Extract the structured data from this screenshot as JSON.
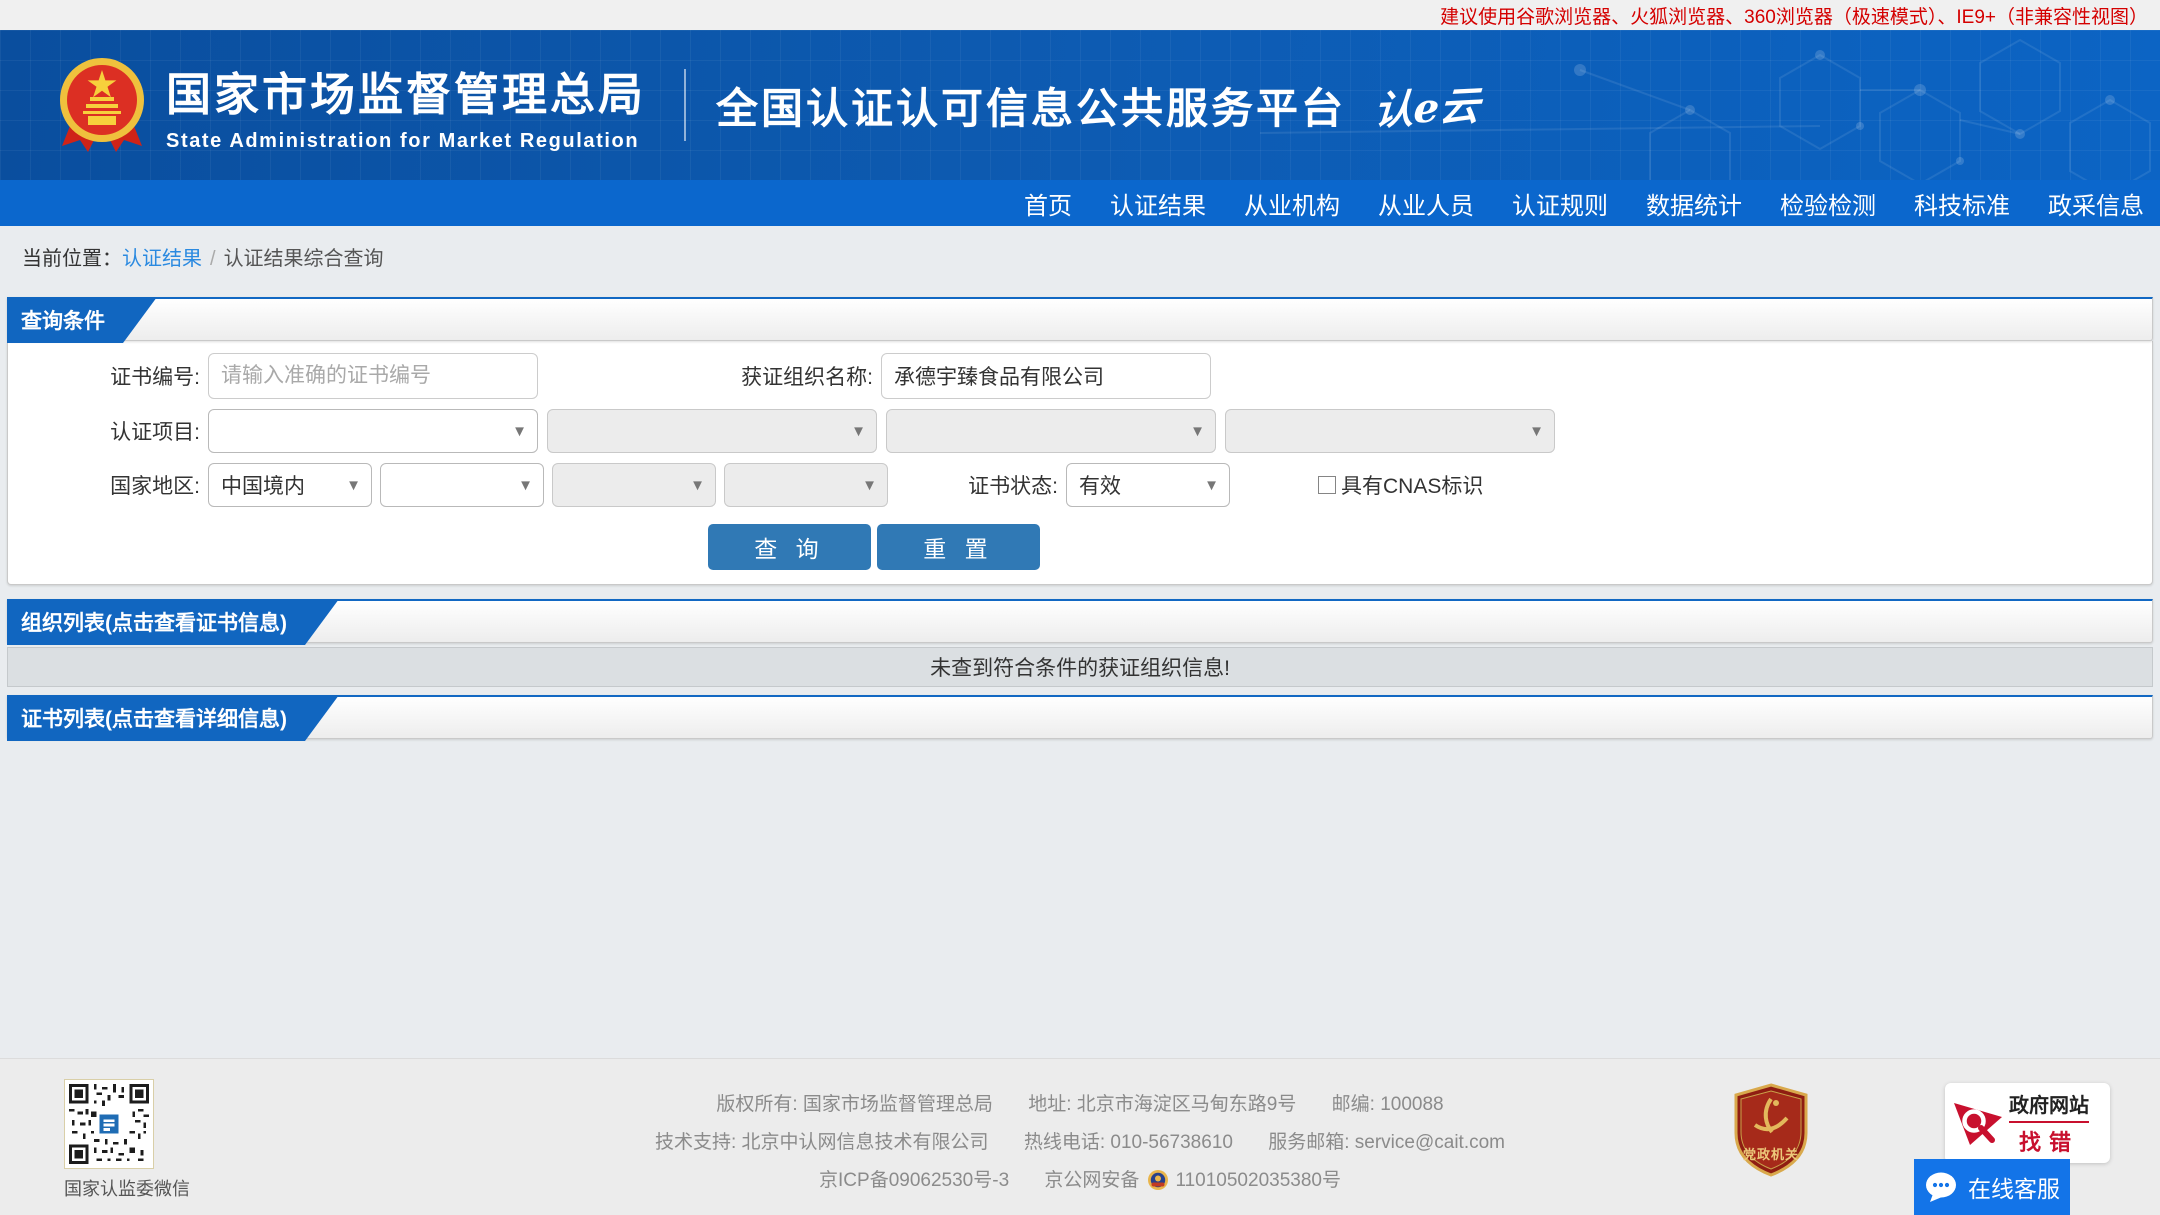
{
  "topbar": {
    "notice": "建议使用谷歌浏览器、火狐浏览器、360浏览器（极速模式）、IE9+（非兼容性视图）"
  },
  "header": {
    "org_name_cn": "国家市场监督管理总局",
    "org_name_en": "State Administration for Market Regulation",
    "platform_title": "全国认证认可信息公共服务平台",
    "logo_text": "认e云"
  },
  "nav": {
    "items": [
      "首页",
      "认证结果",
      "从业机构",
      "从业人员",
      "认证规则",
      "数据统计",
      "检验检测",
      "科技标准",
      "政采信息"
    ]
  },
  "breadcrumb": {
    "prefix": "当前位置：",
    "section_link": "认证结果",
    "separator": "/",
    "current": "认证结果综合查询"
  },
  "query": {
    "section_title": "查询条件",
    "fields": {
      "cert_no_label": "证书编号:",
      "cert_no_placeholder": "请输入准确的证书编号",
      "org_name_label": "获证组织名称:",
      "org_name_value": "承德宇臻食品有限公司",
      "project_label": "认证项目:",
      "region_label": "国家地区:",
      "region_value": "中国境内",
      "status_label": "证书状态:",
      "status_value": "有效",
      "cnas_label": "具有CNAS标识",
      "cnas_checked": false
    },
    "buttons": {
      "search": "查 询",
      "reset": "重 置"
    }
  },
  "org_list": {
    "section_title": "组织列表(点击查看证书信息)",
    "empty_message": "未查到符合条件的获证组织信息!"
  },
  "cert_list": {
    "section_title": "证书列表(点击查看详细信息)"
  },
  "footer": {
    "qr_caption": "国家认监委微信",
    "copyright": "版权所有: 国家市场监督管理总局",
    "address": "地址: 北京市海淀区马甸东路9号",
    "postcode": "邮编: 100088",
    "tech_support": "技术支持: 北京中认网信息技术有限公司",
    "hotline": "热线电话: 010-56738610",
    "email": "服务邮箱: service@cait.com",
    "icp": "京ICP备09062530号-3",
    "police_prefix": "京公网安备",
    "police_number": "11010502035380号",
    "party_badge": "党政机关",
    "site_check_line1": "政府网站",
    "site_check_line2": "找错",
    "service_button": "在线客服"
  },
  "colors": {
    "header_blue": "#0c64c4",
    "nav_blue": "#0b67cd",
    "tab_blue": "#1166c0",
    "button_blue": "#3079b5",
    "link_blue": "#2b8ae0",
    "notice_red": "#d40000",
    "service_blue": "#1374e8",
    "badge_red": "#c8102e",
    "page_bg": "#e9ecef"
  }
}
